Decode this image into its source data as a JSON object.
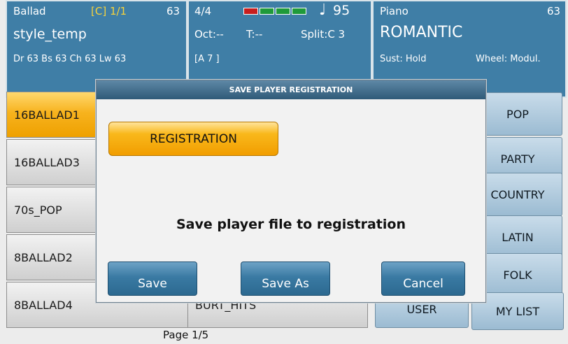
{
  "header_left": {
    "style_name": "Ballad",
    "chord_index": "[C] 1/1",
    "style_num": "63",
    "file_name": "style_temp",
    "parts": "Dr 63  Bs 63  Ch 63  Lw 63"
  },
  "header_mid": {
    "time_sig": "4/4",
    "tempo": "95",
    "oct": "Oct:--",
    "transpose": "T:--",
    "split": "Split:C 3",
    "chord_readout": "[A 7            ]",
    "note_glyph": "♩",
    "meter_colors": [
      "#c81e1e",
      "#1f9a3a",
      "#1f9a3a",
      "#1f9a3a"
    ]
  },
  "header_right": {
    "voice_type": "Piano",
    "voice_num": "63",
    "voice_name": "ROMANTIC",
    "sustain": "Sust: Hold",
    "wheel": "Wheel: Modul."
  },
  "list": {
    "items": [
      "16BALLAD1",
      "16BALLAD3",
      "70s_POP",
      "8BALLAD2",
      "8BALLAD4"
    ],
    "mid_item": "BURT_HITS",
    "page": "Page 1/5"
  },
  "categories": {
    "right_col": [
      "POP",
      "PARTY",
      "COUNTRY",
      "LATIN",
      "FOLK",
      "MY LIST"
    ],
    "user": "USER"
  },
  "dialog": {
    "title": "SAVE PLAYER REGISTRATION",
    "registration_label": "REGISTRATION",
    "message": "Save player file to registration",
    "save_label": "Save",
    "save_as_label": "Save As",
    "cancel_label": "Cancel"
  }
}
